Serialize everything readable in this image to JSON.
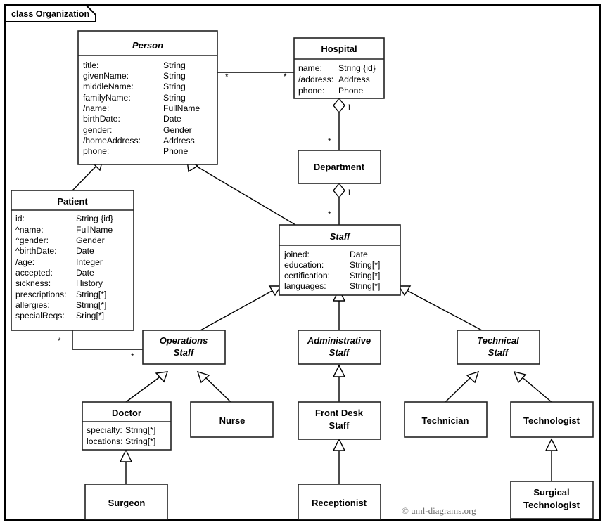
{
  "frame": {
    "label": "class Organization"
  },
  "credit": "© uml-diagrams.org",
  "classes": {
    "person": {
      "name": "Person",
      "abstract": true,
      "attributes": [
        {
          "name": "title:",
          "type": "String"
        },
        {
          "name": "givenName:",
          "type": "String"
        },
        {
          "name": "middleName:",
          "type": "String"
        },
        {
          "name": "familyName:",
          "type": "String"
        },
        {
          "name": "/name:",
          "type": "FullName"
        },
        {
          "name": "birthDate:",
          "type": "Date"
        },
        {
          "name": "gender:",
          "type": "Gender"
        },
        {
          "name": "/homeAddress:",
          "type": "Address"
        },
        {
          "name": "phone:",
          "type": "Phone"
        }
      ]
    },
    "hospital": {
      "name": "Hospital",
      "abstract": false,
      "attributes": [
        {
          "name": "name:",
          "type": "String {id}"
        },
        {
          "name": "/address:",
          "type": "Address"
        },
        {
          "name": "phone:",
          "type": "Phone"
        }
      ]
    },
    "department": {
      "name": "Department",
      "abstract": false,
      "attributes": []
    },
    "patient": {
      "name": "Patient",
      "abstract": false,
      "attributes": [
        {
          "name": "id:",
          "type": "String {id}"
        },
        {
          "name": "^name:",
          "type": "FullName"
        },
        {
          "name": "^gender:",
          "type": "Gender"
        },
        {
          "name": "^birthDate:",
          "type": "Date"
        },
        {
          "name": "/age:",
          "type": "Integer"
        },
        {
          "name": "accepted:",
          "type": "Date"
        },
        {
          "name": "sickness:",
          "type": "History"
        },
        {
          "name": "prescriptions:",
          "type": "String[*]"
        },
        {
          "name": "allergies:",
          "type": "String[*]"
        },
        {
          "name": "specialReqs:",
          "type": "Sring[*]"
        }
      ]
    },
    "staff": {
      "name": "Staff",
      "abstract": true,
      "attributes": [
        {
          "name": "joined:",
          "type": "Date"
        },
        {
          "name": "education:",
          "type": "String[*]"
        },
        {
          "name": "certification:",
          "type": "String[*]"
        },
        {
          "name": "languages:",
          "type": "String[*]"
        }
      ]
    },
    "operations_staff": {
      "name_line1": "Operations",
      "name_line2": "Staff",
      "abstract": true
    },
    "administrative_staff": {
      "name_line1": "Administrative",
      "name_line2": "Staff",
      "abstract": true
    },
    "technical_staff": {
      "name_line1": "Technical",
      "name_line2": "Staff",
      "abstract": true
    },
    "doctor": {
      "name": "Doctor",
      "abstract": false,
      "attributes": [
        {
          "name": "specialty:",
          "type": "String[*]"
        },
        {
          "name": "locations:",
          "type": "String[*]"
        }
      ]
    },
    "nurse": {
      "name": "Nurse",
      "abstract": false
    },
    "front_desk_staff": {
      "name_line1": "Front Desk",
      "name_line2": "Staff",
      "abstract": false
    },
    "technician": {
      "name": "Technician",
      "abstract": false
    },
    "technologist": {
      "name": "Technologist",
      "abstract": false
    },
    "surgeon": {
      "name": "Surgeon",
      "abstract": false
    },
    "receptionist": {
      "name": "Receptionist",
      "abstract": false
    },
    "surgical_technologist": {
      "name_line1": "Surgical",
      "name_line2": "Technologist",
      "abstract": false
    }
  },
  "multiplicities": {
    "person_hospital_person_end": "*",
    "person_hospital_hospital_end": "*",
    "hospital_department_hospital_end": "1",
    "hospital_department_department_end": "*",
    "department_staff_department_end": "1",
    "department_staff_staff_end": "*",
    "patient_operations_patient_end": "*",
    "patient_operations_operations_end": "*"
  },
  "colors": {
    "stroke": "#222222",
    "frame_stroke": "#000000",
    "fill": "#ffffff",
    "credit": "#6f6f6f"
  }
}
